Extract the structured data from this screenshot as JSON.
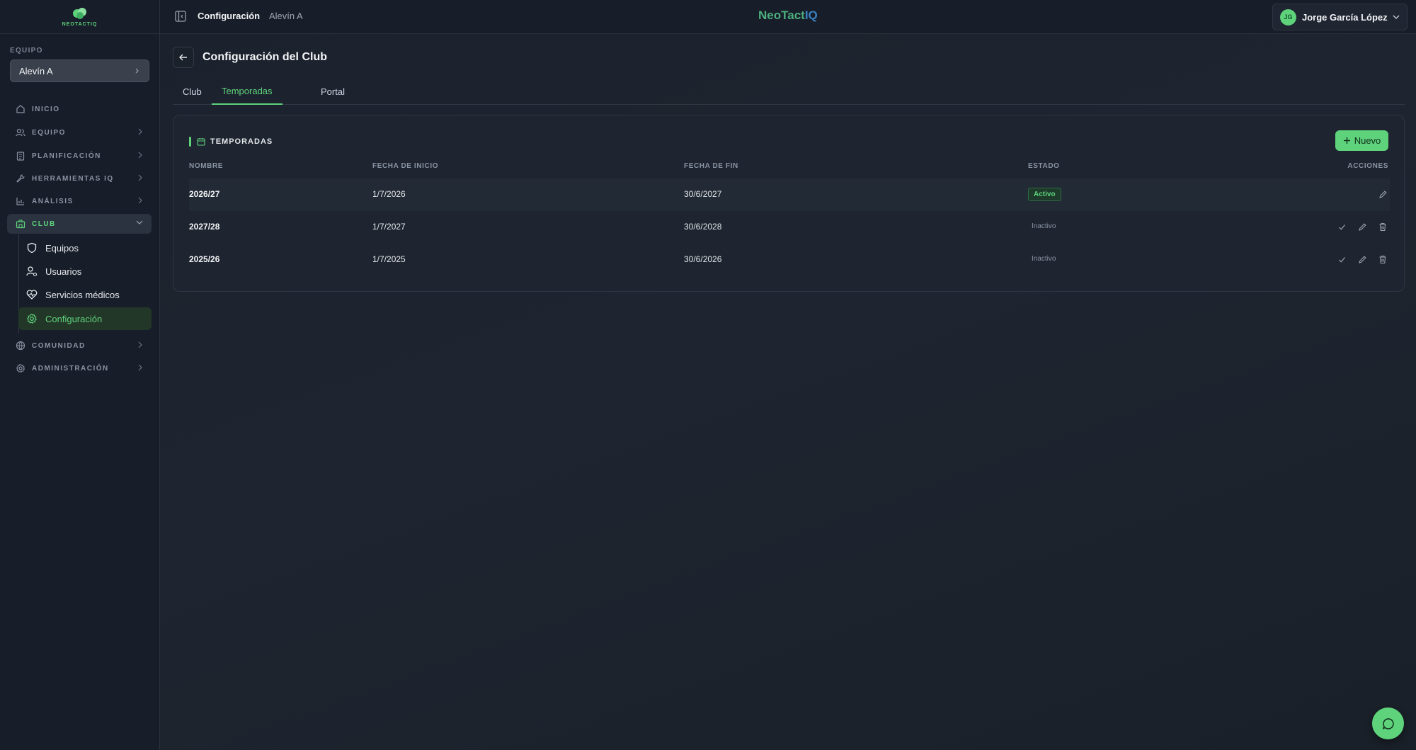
{
  "app": {
    "logo_text": "NEOTACTIQ",
    "brand_part1": "NeoTact",
    "brand_part2": "IQ"
  },
  "sidebar": {
    "team_label": "EQUIPO",
    "team_value": "Alevín A",
    "nav": [
      {
        "label": "INICIO",
        "icon": "home-icon"
      },
      {
        "label": "EQUIPO",
        "icon": "users-icon"
      },
      {
        "label": "PLANIFICACIÓN",
        "icon": "clipboard-icon"
      },
      {
        "label": "HERRAMIENTAS IQ",
        "icon": "wrench-icon"
      },
      {
        "label": "ANÁLISIS",
        "icon": "bar-chart-icon"
      },
      {
        "label": "CLUB",
        "icon": "building-icon"
      },
      {
        "label": "COMUNIDAD",
        "icon": "globe-icon"
      },
      {
        "label": "ADMINISTRACIÓN",
        "icon": "settings-icon"
      }
    ],
    "club_sub": [
      {
        "label": "Equipos",
        "icon": "shield-icon"
      },
      {
        "label": "Usuarios",
        "icon": "user-cog-icon"
      },
      {
        "label": "Servicios médicos",
        "icon": "heart-pulse-icon"
      },
      {
        "label": "Configuración",
        "icon": "gear-icon"
      }
    ]
  },
  "topbar": {
    "breadcrumb_current": "Configuración",
    "breadcrumb_team": "Alevín A",
    "user_initials": "JG",
    "user_name": "Jorge García López"
  },
  "page": {
    "title": "Configuración del Club",
    "tabs": [
      "Club",
      "Temporadas",
      "Portal"
    ],
    "active_tab": "Temporadas"
  },
  "seasons": {
    "section_title": "TEMPORADAS",
    "new_button": "Nuevo",
    "columns": [
      "NOMBRE",
      "FECHA DE INICIO",
      "FECHA DE FIN",
      "ESTADO",
      "ACCIONES"
    ],
    "rows": [
      {
        "name": "2026/27",
        "start": "1/7/2026",
        "end": "30/6/2027",
        "status": "Activo"
      },
      {
        "name": "2027/28",
        "start": "1/7/2027",
        "end": "30/6/2028",
        "status": "Inactivo"
      },
      {
        "name": "2025/26",
        "start": "1/7/2025",
        "end": "30/6/2026",
        "status": "Inactivo"
      }
    ]
  },
  "colors": {
    "accent": "#5ed37b",
    "background": "#1c222d",
    "brand_blue": "#3b82c4"
  }
}
